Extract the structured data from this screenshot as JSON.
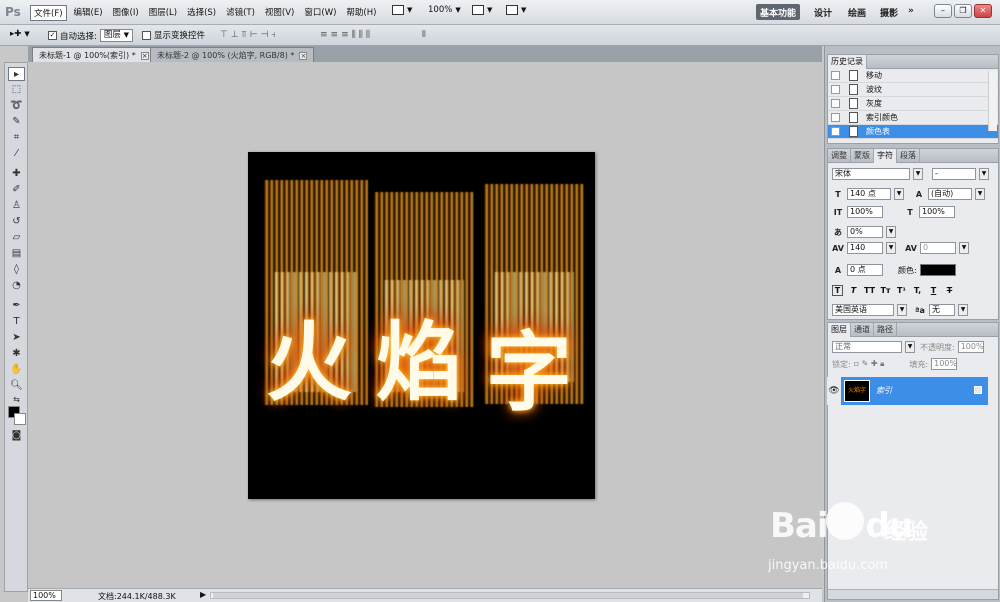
{
  "app": {
    "logo": "Ps",
    "menus": [
      "文件(F)",
      "编辑(E)",
      "图像(I)",
      "图层(L)",
      "选择(S)",
      "滤镜(T)",
      "视图(V)",
      "窗口(W)",
      "帮助(H)"
    ],
    "zoom_display": "100%",
    "workspaces": [
      "基本功能",
      "设计",
      "绘画",
      "摄影"
    ],
    "more": "»"
  },
  "options": {
    "auto_select_label": "自动选择:",
    "auto_select_value": "图层",
    "show_transform_label": "显示变换控件"
  },
  "tabs": [
    {
      "label": "未标题-1 @ 100%(索引) *"
    },
    {
      "label": "未标题-2 @ 100% (火焰字, RGB/8) *"
    }
  ],
  "canvas": {
    "text_chars": [
      "火",
      "焰",
      "字"
    ],
    "background_color": "#000000"
  },
  "status": {
    "zoom": "100%",
    "doc_info": "文档:244.1K/488.3K",
    "arrow": "▶"
  },
  "history": {
    "title": "历史记录",
    "items": [
      "移动",
      "波纹",
      "灰度",
      "索引颜色",
      "颜色表"
    ]
  },
  "character": {
    "tabs": [
      "调整",
      "蒙版",
      "字符",
      "段落"
    ],
    "font_family": "宋体",
    "font_style": "-",
    "size": "140 点",
    "leading": "(自动)",
    "vscale": "100%",
    "hscale": "100%",
    "tsume": "0%",
    "tracking": "140",
    "kerning": "0",
    "baseline": "0 点",
    "color_label": "颜色:",
    "color_value": "#000000",
    "fx_buttons": [
      "T",
      "T",
      "TT",
      "Tт",
      "T¹",
      "T,",
      "T",
      "T"
    ],
    "language": "美国英语",
    "aa_label": "ªa",
    "antialias": "无"
  },
  "layers": {
    "tabs": [
      "图层",
      "通道",
      "路径"
    ],
    "blend_mode": "正常",
    "opacity_label": "不透明度:",
    "opacity": "100%",
    "lock_label": "锁定:",
    "fill_label": "填充:",
    "fill": "100%",
    "layer_name": "索引",
    "layer_thumb_text": "火焰字"
  },
  "watermark": {
    "brand": "Bai",
    "brand2": "du",
    "cn": "经验",
    "url": "jingyan.baidu.com"
  }
}
